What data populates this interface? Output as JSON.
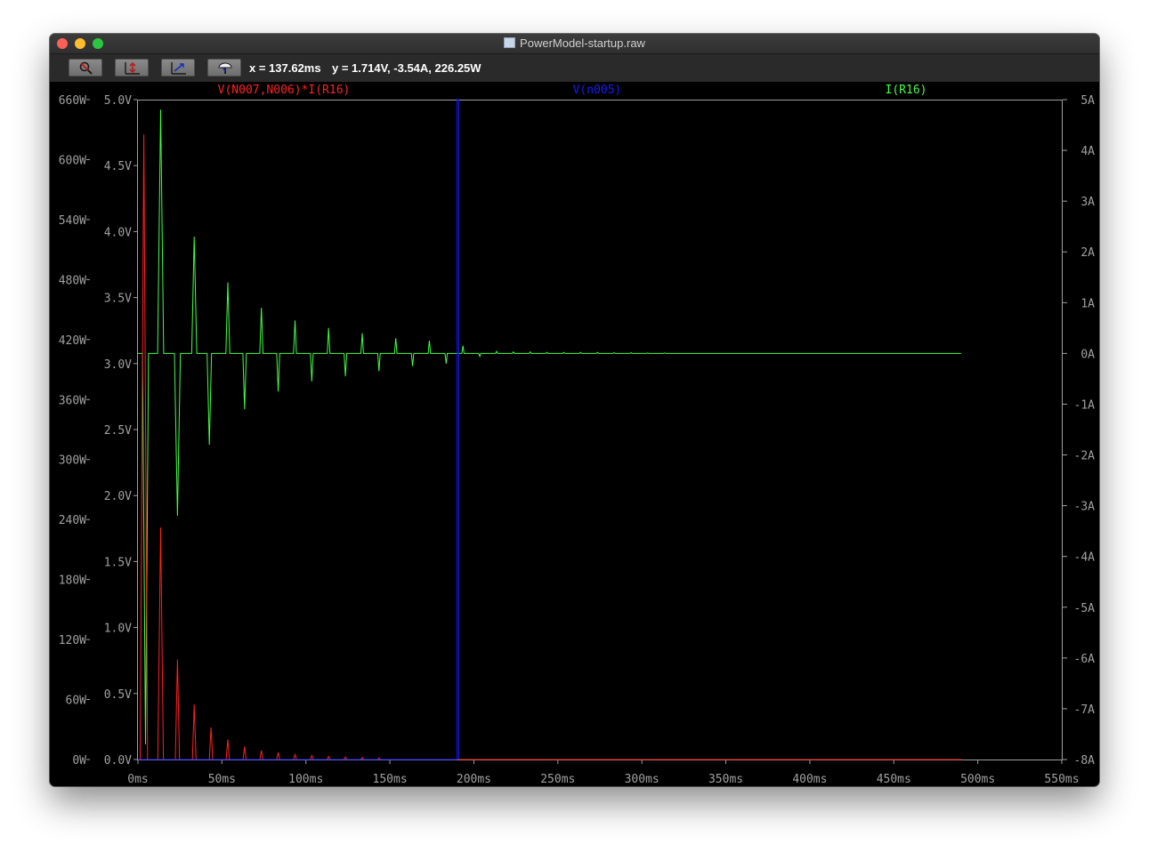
{
  "window": {
    "title": "PowerModel-startup.raw"
  },
  "toolbar": {
    "cursor_x": "x = 137.62ms",
    "cursor_y": "y = 1.714V, -3.54A, 226.25W"
  },
  "chart_data": {
    "type": "line",
    "title": "",
    "background": "#000000",
    "grid": false,
    "x_axis": {
      "range": [
        0,
        550
      ],
      "unit": "ms",
      "ticks": [
        0,
        50,
        100,
        150,
        200,
        250,
        300,
        350,
        400,
        450,
        500,
        550
      ],
      "tick_labels": [
        "0ms",
        "50ms",
        "100ms",
        "150ms",
        "200ms",
        "250ms",
        "300ms",
        "350ms",
        "400ms",
        "450ms",
        "500ms",
        "550ms"
      ]
    },
    "y_axis_left_power": {
      "range": [
        0,
        660
      ],
      "ticks": [
        0,
        60,
        120,
        180,
        240,
        300,
        360,
        420,
        480,
        540,
        600,
        660
      ],
      "tick_labels": [
        "0W",
        "60W",
        "120W",
        "180W",
        "240W",
        "300W",
        "360W",
        "420W",
        "480W",
        "540W",
        "600W",
        "660W"
      ]
    },
    "y_axis_left_voltage": {
      "range": [
        0,
        5
      ],
      "ticks": [
        0,
        0.5,
        1,
        1.5,
        2,
        2.5,
        3,
        3.5,
        4,
        4.5,
        5
      ],
      "tick_labels": [
        "0.0V",
        "0.5V",
        "1.0V",
        "1.5V",
        "2.0V",
        "2.5V",
        "3.0V",
        "3.5V",
        "4.0V",
        "4.5V",
        "5.0V"
      ]
    },
    "y_axis_right_current": {
      "range": [
        -8,
        5
      ],
      "ticks": [
        5,
        4,
        3,
        2,
        1,
        0,
        -1,
        -2,
        -3,
        -4,
        -5,
        -6,
        -7,
        -8
      ],
      "tick_labels": [
        "5A",
        "4A",
        "3A",
        "2A",
        "1A",
        "0A",
        "-1A",
        "-2A",
        "-3A",
        "-4A",
        "-5A",
        "-6A",
        "-7A",
        "-8A"
      ]
    },
    "series": [
      {
        "name": "V(N007,N006)*I(R16)",
        "axis": "power",
        "color": "#ff2020",
        "period": 10,
        "start": 0,
        "end": 490,
        "peaks": [
          [
            3.5,
            625
          ],
          [
            13.5,
            232
          ],
          [
            23.5,
            100
          ],
          [
            33.5,
            55
          ],
          [
            43.5,
            32
          ],
          [
            53.5,
            20
          ],
          [
            63.5,
            13
          ],
          [
            73.5,
            9
          ],
          [
            83.5,
            7
          ],
          [
            93.5,
            5
          ],
          [
            103.5,
            4
          ],
          [
            113.5,
            3
          ],
          [
            123.5,
            2.5
          ],
          [
            133.5,
            2
          ],
          [
            143.5,
            1.5
          ]
        ]
      },
      {
        "name": "V(n005)",
        "axis": "voltage",
        "color": "#1a1aff",
        "points": [
          [
            0,
            0
          ],
          [
            190,
            0
          ],
          [
            190,
            5
          ],
          [
            191,
            5
          ],
          [
            191,
            0
          ]
        ]
      },
      {
        "name": "I(R16)",
        "axis": "current",
        "color": "#40ff40",
        "period": 10,
        "end": 490,
        "pulses": [
          [
            4.5,
            -7.7
          ],
          [
            13.5,
            4.8
          ],
          [
            23.5,
            -3.2
          ],
          [
            33.5,
            2.3
          ],
          [
            42.5,
            -1.8
          ],
          [
            53.5,
            1.4
          ],
          [
            63.5,
            -1.1
          ],
          [
            73.5,
            0.9
          ],
          [
            83.5,
            -0.75
          ],
          [
            93.5,
            0.65
          ],
          [
            103.5,
            -0.55
          ],
          [
            113.5,
            0.5
          ],
          [
            123.5,
            -0.45
          ],
          [
            133.5,
            0.4
          ],
          [
            143.5,
            -0.35
          ],
          [
            153.5,
            0.3
          ],
          [
            163.5,
            -0.25
          ],
          [
            173.5,
            0.25
          ],
          [
            183.5,
            -0.2
          ],
          [
            193.5,
            0.15
          ],
          [
            203.5,
            -0.06
          ],
          [
            213.5,
            0.04
          ],
          [
            223.5,
            0.03
          ],
          [
            233.5,
            0.03
          ],
          [
            243.5,
            0.02
          ],
          [
            253.5,
            0.02
          ],
          [
            263.5,
            0.02
          ],
          [
            273.5,
            0.02
          ],
          [
            283.5,
            0.015
          ],
          [
            293.5,
            0.015
          ],
          [
            303.5,
            0.01
          ],
          [
            313.5,
            0.01
          ]
        ]
      }
    ],
    "cursor": {
      "x": 137.62
    }
  }
}
